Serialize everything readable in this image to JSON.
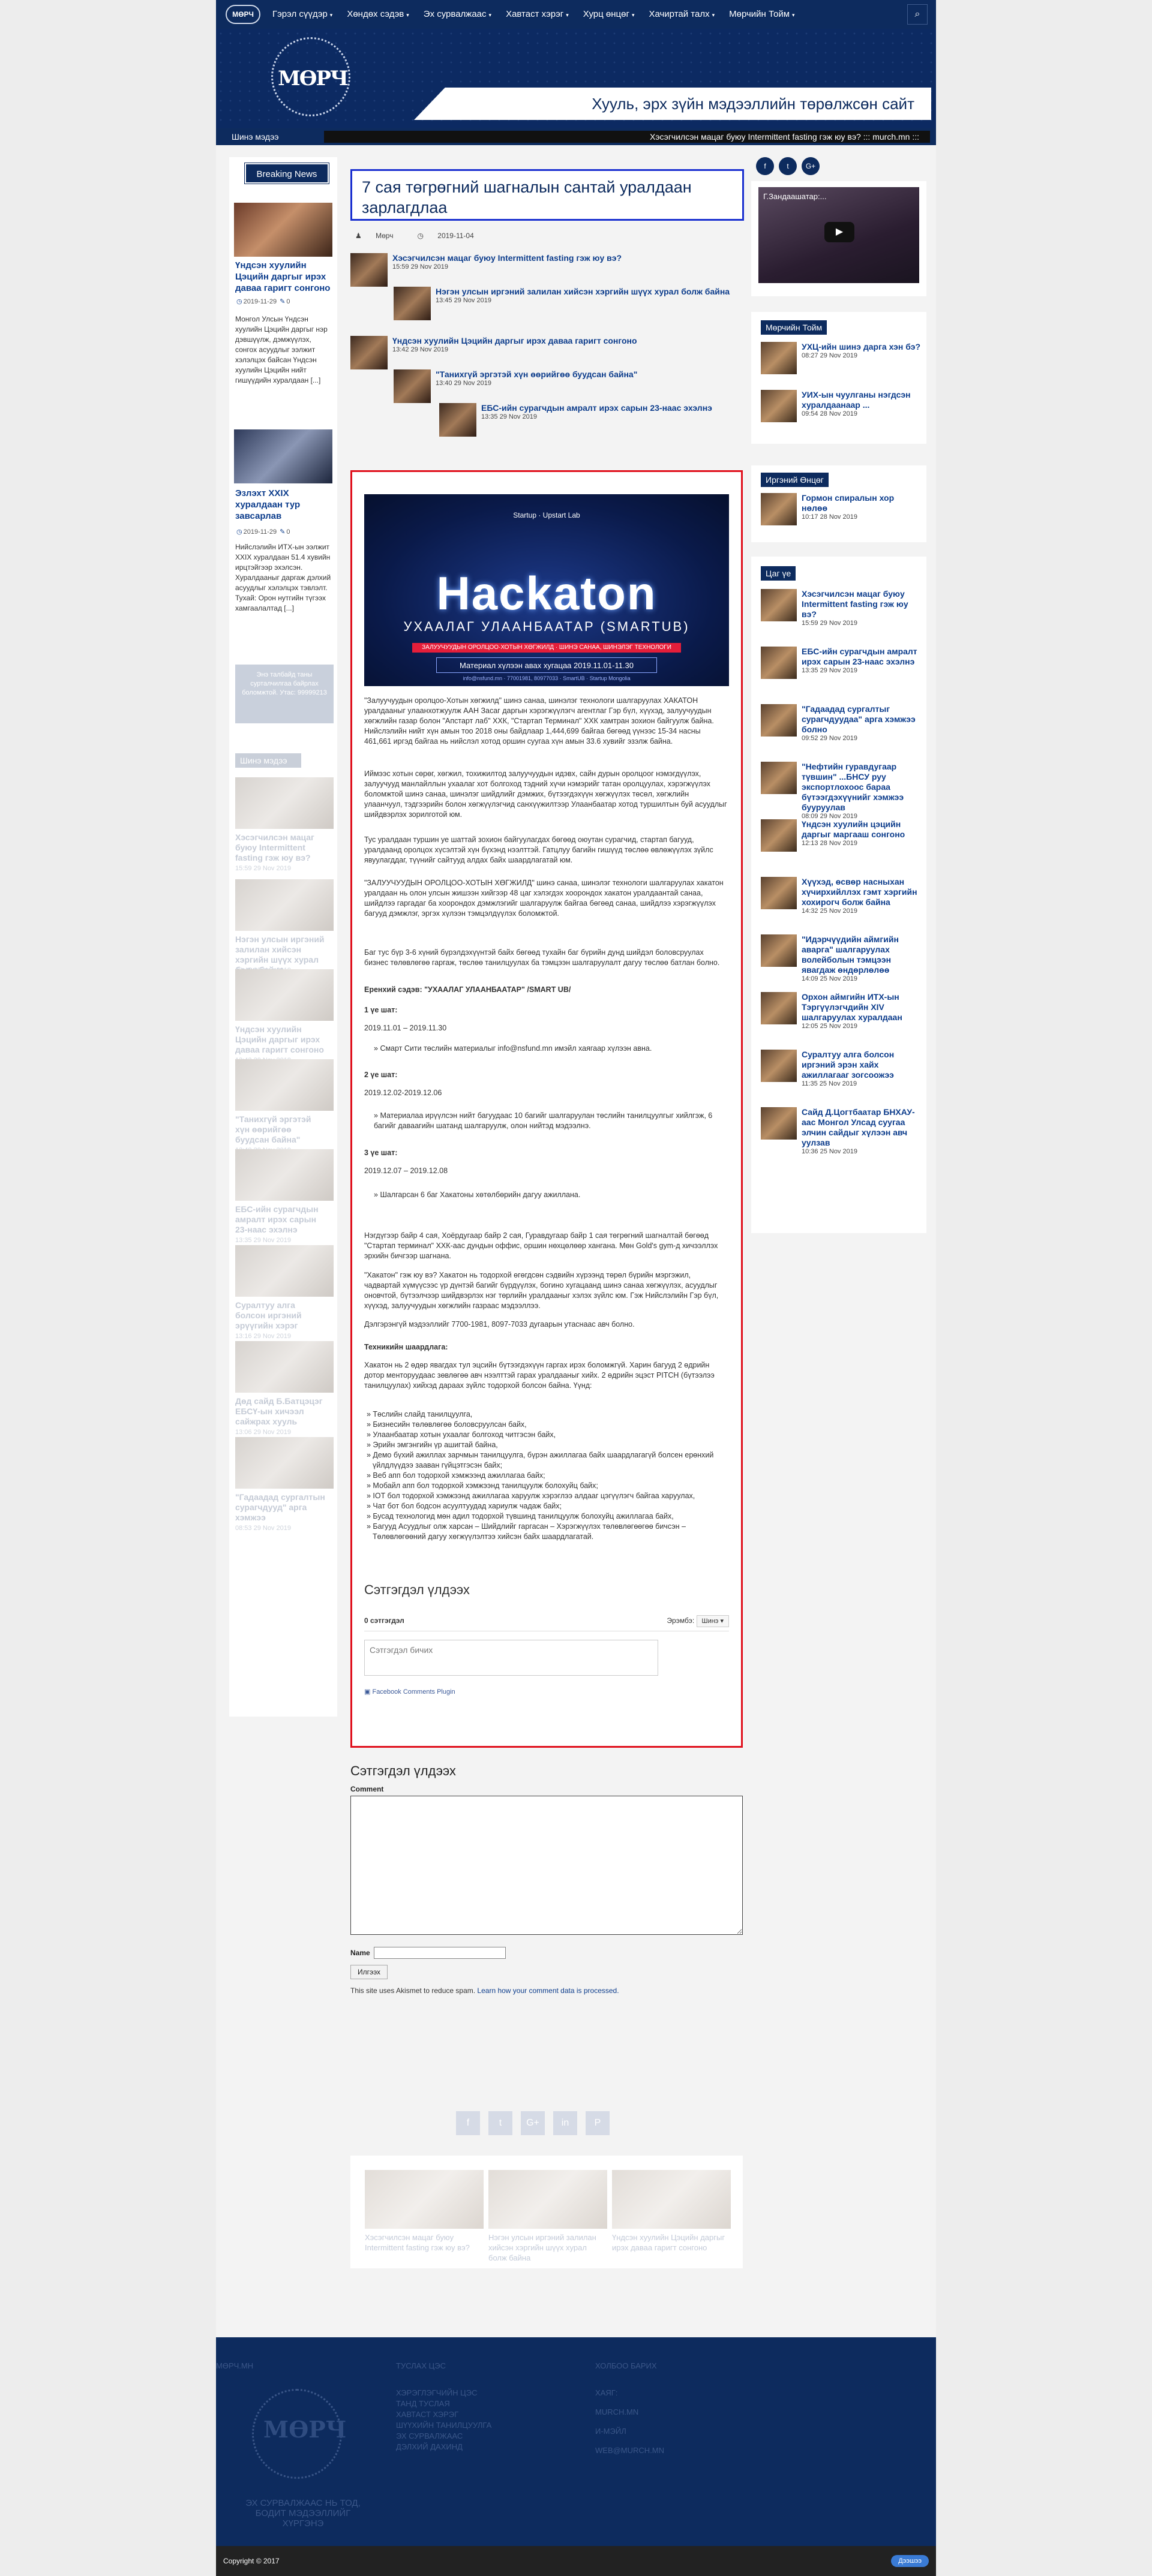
{
  "nav": {
    "logo": "МӨРЧ",
    "items": [
      {
        "label": "Гэрэл сүүдэр",
        "caret": true
      },
      {
        "label": "Хөндөх сэдэв",
        "caret": true
      },
      {
        "label": "Эх сурвалжаас",
        "caret": true
      },
      {
        "label": "Хавтаст хэрэг",
        "caret": true
      },
      {
        "label": "Хурц өнцөг",
        "caret": true
      },
      {
        "label": "Хачиртай талх",
        "caret": true
      },
      {
        "label": "Мөрчийн Тойм",
        "caret": true
      }
    ],
    "search_icon": "⌕"
  },
  "header": {
    "logo_text": "МӨРЧ",
    "tagline": "Хууль, эрх зүйн мэдээллийн төрөлжсөн сайт"
  },
  "ticker": {
    "label": "Шинэ мэдээ",
    "text": "Хэсэгчилсэн мацаг буюу Intermittent fasting гэж юу вэ? ::: murch.mn :::"
  },
  "left": {
    "breaking": "Breaking News",
    "items": [
      {
        "title": "Үндсэн хуулийн Цэцийн даргыг ирэх даваа гаригт сонгоно",
        "date": "2019-11-29",
        "comments": "0",
        "text": "Монгол Улсын Үндсэн хуулийн Цэцийн даргыг нэр дэвшүүлж, дэмжүүлэх, сонгох асуудлыг ээлжит хэлэлцэх байсан Үндсэн хуулийн Цэцийн нийт гишүүдийн хуралдаан [...]"
      },
      {
        "title": "Эзлэхт XXIX хуралдаан тур завсарлав",
        "date": "2019-11-29",
        "comments": "0",
        "text": "Нийслэлийн ИТХ-ын ээлжит XXIX хуралдаан 51.4 хувийн ирцтэйгээр эхэлсэн. Хуралдааныг даргаж дэлхий асуудлыг хэлэлцэх тэвлэлт. Тухай: Орон нутгийн түгээх хамгаалалтад [...]"
      }
    ],
    "ghost_box": "Энэ талбайд таны сурталчилгаа байрлах боломжтой. Утас: 99999213",
    "ghost_head": "Шинэ мэдээ",
    "ghost_items": [
      {
        "t": "Хэсэгчилсэн мацаг буюу Intermittent fasting гэж юу вэ?",
        "d": "15:59 29 Nov 2019"
      },
      {
        "t": "Нэгэн улсын иргэний залилан хийсэн хэргийн шүүх хурал болж байна",
        "d": "13:45 29 Nov 2019"
      },
      {
        "t": "Үндсэн хуулийн Цэцийн даргыг ирэх даваа гаригт сонгоно",
        "d": "13:42 29 Nov 2019"
      },
      {
        "t": "\"Танихгүй эргэтэй хүн өөрийгөө буудсан байна\"",
        "d": "13:40 29 Nov 2019"
      },
      {
        "t": "ЕБС-ийн сурагчдын амралт ирэх сарын 23-наас эхэлнэ",
        "d": "13:35 29 Nov 2019"
      },
      {
        "t": "Суралтуу алга болсон иргэний эрүүгийн хэрэг",
        "d": "13:16 29 Nov 2019"
      },
      {
        "t": "Дөд сайд Б.Батцэцэг ЕБСҮ-ын хичээл сайжрах хууль",
        "d": "13:06 29 Nov 2019"
      },
      {
        "t": "\"Гадаадад сургалтын сурагчдууд\" арга хэмжээ",
        "d": "08:53 29 Nov 2019"
      }
    ]
  },
  "article": {
    "title": "7 сая төгрөгний шагналын сантай уралдаан зарлагдлаа",
    "author": "Мөрч",
    "date": "2019-11-04",
    "related_posts": [
      {
        "t": "Хэсэгчилсэн мацаг буюу Intermittent fasting гэж юу вэ?",
        "d": "15:59 29 Nov 2019"
      },
      {
        "t": "Нэгэн улсын иргэний залилан хийсэн хэргийн шүүх хурал болж байна",
        "d": "13:45 29 Nov 2019"
      },
      {
        "t": "Үндсэн хуулийн Цэцийн даргыг ирэх даваа гаригт сонгоно",
        "d": "13:42 29 Nov 2019"
      },
      {
        "t": "\"Танихгүй эргэтэй хүн өөрийгөө буудсан байна\"",
        "d": "13:40 29 Nov 2019"
      },
      {
        "t": "ЕБС-ийн сурагчдын амралт ирэх сарын 23-наас эхэлнэ",
        "d": "13:35 29 Nov 2019"
      }
    ],
    "banner": {
      "top": "Startup · Upstart Lab",
      "title": "Hackaton",
      "subtitle": "УХААЛАГ УЛААНБААТАР (SMARTUB)",
      "bar": "ЗАЛУУЧУУДЫН ОРОЛЦОО·ХОТЫН ХӨГЖИЛД · ШИНЭ САНАА, ШИНЭЛЭГ ТЕХНОЛОГИ",
      "date": "Материал хүлээн авах хугацаа 2019.11.01-11.30",
      "foot": "info@nsfund.mn · 77001981, 80977033 · SmartUB · Startup Mongolia"
    },
    "p1": "\"Залуучуудын оролцоо-Хотын хөгжилд\" шинэ санаа, шинэлэг технологи шалгаруулах ХАКАТОН уралдааныг улаанхотжуулж ААН Засаг даргын хэрэгжүүлэгч агентлаг Гэр бүл, хүүхэд, залуучуудын хөгжлийн газар болон \"Апстарт лаб\" ХХК, \"Стартап Терминал\" ХХК хамтран зохион байгуулж байна. Нийслэлийн нийт хүн амын тоо 2018 оны байдлаар 1,444,699 байгаа бөгөөд үүнээс 15-34 насны 461,661 иргэд байгаа нь нийслэл хотод оршин суугаа хүн амын 33.6 хувийг эзэлж байна.",
    "p2": "Иймээс хотын сөрөг, хөгжил, тохижилтод залуучуудын идэвх, сайн дурын оролцоог нэмэгдүүлэх, залуучууд манлайллын ухаалаг хот болгоход тэдний хүчи нэмэрийг татан оролцуулах, хэрэгжүүлэх боломжтой шинэ санаа, шинэлэг шийдлийг дэмжих, бүтээгдэхүүн хөгжүүлэх төсөл, хөгжлийн улаанчуул, тэдгээрийн болон хөгжүүлэгчид санхүүжилтээр Улаанбаатар хотод туршилтын буй асуудлыг шийдвэрлэх зорилготой юм.",
    "p3": "Тус уралдаан туршин уе шаттай зохион байгуулагдах бөгөөд оюутан сурагчид, стартап багууд, уралдаанд оролцох хүсэлтэй хүн бүхэнд нээлттэй. Гатцлуу багийн гишүүд төслөө өвлөжүүлэх зүйлс явуулагддаг, түүнийг сайтууд алдах байх шаардлагатай юм.",
    "p4": "\"ЗАЛУУЧУУДЫН ОРОЛЦОО-ХОТЫН ХӨГЖИЛД\" шинэ санаа, шинэлэг технологи шалгаруулах хакатон уралдаан нь олон улсын жишээн хийгээр 48 цаг хэлэгдэх хоорондох хакатон уралдаантай санаа, шийдлээ гаргадаг ба хоорондох дэмжлэгийг шалгаруулж байгаа бөгөөд санаа, шийдлээ хэрэгжүүлэх багууд дэмжлэг, эргэх хүлээн тэмцэлдүүлэх боломжтой.",
    "p5": "Баг тус бүр 3-6 хүний бүрэлдэхүүнтэй байх бөгөөд тухайн баг бүрийн дунд шийдэл боловсруулах бизнес төлөвлөгөө гаргаж, төслөө танилцуулах ба тэмцээн шалгаруулалт дагуу төслөө батлан болно.",
    "focus": "Еренхий сэдэв: \"УХААЛАГ УЛААНБААТАР\" /SMART UB/",
    "s1h": "1 үе шат:",
    "s1d": "2019.11.01 – 2019.11.30",
    "s1t": "Смарт Сити төслийн материалыг info@nsfund.mn имэйл хаягаар хүлээн авна.",
    "s2h": "2 үе шат:",
    "s2d": "2019.12.02-2019.12.06",
    "s2t": "Материалаа ирүүлсэн нийт багуудаас 10 багийг шалгаруулан төслийн танилцуулгыг хийлгэж, 6 багийг даваагийн шатанд шалгаруулж, олон нийтэд мэдээлнэ.",
    "s3h": "3 үе шат:",
    "s3d": "2019.12.07 – 2019.12.08",
    "s3t": "Шалгарсан 6 баг Хакатоны хөтөлбөрийн дагуу ажиллана.",
    "p6": "Нэгдүгээр байр 4 сая, Хоёрдугаар байр 2 сая, Гуравдугаар байр 1 сая төгрөгний шагналтай бөгөөд \"Стартап терминал\" ХХК-аас дундын оффис, оршин нөхцөлөөр хангана. Мөн Gold's gym-д хичээллэх эрхийн бичгээр шагнана.",
    "p7": "\"Хакатон\" гэж юу вэ? Хакатон нь тодорхой өгөгдсөн сэдвийн хүрээнд төрөл бүрийн мэргэжил, чадвартай хүмүүсээс үр дүнтэй багийг бүрдүүлэх, богино хугацаанд шинэ санаа хөгжүүлэх, асуудлыг оновчтой, бүтээлчээр шийдвэрлэх нэг төрлийн уралдааныг хэлэх зүйлс юм. Гэж Нийслэлийн Гэр бүл, хүүхэд, залуучуудын хөгжлийн газраас мэдээллээ.",
    "contact": "Дэлгэрэнгүй мэдээллийг 7700-1981, 8097-7033 дугаарын утаснаас авч болно.",
    "tech_h": "Техникийн шаардлага:",
    "tech_p": "Хакатон нь 2 өдөр явагдах тул эцсийн бүтээгдэхүүн гаргах ирэх боломжгүй. Харин багууд 2 өдрийн дотор менторуудаас зөвлөгөө авч нээлттэй гарах уралдааныг хийх. 2 өдрийн эцэст PITCH (бүтээлээ танилцуулах) хийхэд дараах зүйлс тодорхой болсон байна. Үүнд:",
    "tech_list": [
      "Төслийн слайд танилцуулга,",
      "Бизнесийн төлөвлөгөө боловсруулсан байх,",
      "Улаанбаатар хотын ухаалаг болгоход читгэсэн байх,",
      "Эрийн эмгэнгийн үр ашигтай байна,",
      "Демо бүхий ажиллах зарчмын танилцуулга, бүрэн ажиллагаа байх шаардлагагүй болсен ерөнхий үйлдлүүдээ зааван гүйцэтгэсэн байх;",
      "Веб апп бол тодорхой хэмжээнд ажиллагаа байх;",
      "Мобайл апп бол тодорхой хэмжээнд танилцуулж болохуйц байх;",
      "IOT бол тодорхой хэмжээнд ажиллагаа харуулж хэрэглээ алдааг цэгүүлэгч байгаа харуулах,",
      "Чат бот бол бодсон асуултуудад хариулж чадаж байх;",
      "Бусад технологид мөн адил тодорхой түвшинд танилцуулж болохуйц ажиллагаа байх,",
      "Багууд Асуудлыг олж харсан – Шийдлийг гаргасан – Хэрэгжүүлэх төлөвлөгөөгөө бичсэн – Төлөвлөгөөний дагуу хөгжүүлэлтээ хийсэн байх шаардлагатай."
    ],
    "fb": {
      "title": "Сэтгэгдэл үлдээх",
      "count": "0 сэтгэгдэл",
      "sort_label": "Эрэмбэ:",
      "sort_value": "Шинэ ▾",
      "placeholder": "Сэтгэгдэл бичих",
      "plugin": "Facebook Comments Plugin"
    }
  },
  "reply": {
    "title": "Сэтгэгдэл үлдээх",
    "comment_label": "Comment",
    "name_label": "Name",
    "submit": "Илгээх",
    "note": "This site uses Akismet to reduce spam. ",
    "note_link": "Learn how your comment data is processed."
  },
  "share": [
    "f",
    "t",
    "G+",
    "in",
    "P"
  ],
  "related": [
    {
      "t": "Хэсэгчилсэн мацаг буюу Intermittent fasting гэж юу вэ?"
    },
    {
      "t": "Нэгэн улсын иргэний залилан хийсэн хэргийн шүүх хурал болж байна"
    },
    {
      "t": "Үндсэн хуулийн Цэцийн даргыг ирэх даваа гаригт сонгоно"
    }
  ],
  "sidebar": {
    "social": [
      "f",
      "t",
      "G+"
    ],
    "video_title": "Г.Зандаашатар:...",
    "murch_head": "Мөрчийн Тойм",
    "murch": [
      {
        "t": "УХЦ-ийн шинэ дарга хэн бэ?",
        "d": "08:27 29 Nov 2019"
      },
      {
        "t": "УИХ-ын чуулганы нэгдсэн хуралдаанаар ...",
        "d": "09:54 28 Nov 2019"
      }
    ],
    "angle_head": "Иргэний Өнцөг",
    "angle": [
      {
        "t": "Гормон спиралын хор нөлөө",
        "d": "10:17 28 Nov 2019"
      }
    ],
    "time_head": "Цаг үе",
    "time": [
      {
        "t": "Хэсэгчилсэн мацаг буюу Intermittent fasting гэж юу вэ?",
        "d": "15:59 29 Nov 2019"
      },
      {
        "t": "ЕБС-ийн сурагчдын амралт ирэх сарын 23-наас эхэлнэ",
        "d": "13:35 29 Nov 2019"
      },
      {
        "t": "\"Гадаадад сургалтыг сурагчдуудаа\" арга хэмжээ болно",
        "d": "09:52 29 Nov 2019"
      },
      {
        "t": "\"Нефтийн гуравдугаар түвшин\" ...БНСУ руу экспортлохоос бараа бүтээгдэхүүнийг хэмжээ бууруулав",
        "d": "08:09 29 Nov 2019"
      },
      {
        "t": "Үндсэн хуулийн цэцийн даргыг маргааш сонгоно",
        "d": "12:13 28 Nov 2019"
      },
      {
        "t": "Хүүхэд, өсвөр насныхан хүчирхийллэх гэмт хэргийн хохирогч болж байна",
        "d": "14:32 25 Nov 2019"
      },
      {
        "t": "\"Идэрчүүдийн аймгийн аварга\" шалгаруулах волейболын тэмцээн явагдаж өндөрлөлөө",
        "d": "14:09 25 Nov 2019"
      },
      {
        "t": "Орхон аймгийн ИТХ-ын Тэргүүлэгчдийн XIV шалгаруулах хуралдаан",
        "d": "12:05 25 Nov 2019"
      },
      {
        "t": "Суралтуу алга болсон иргэний эрэн хайх ажиллагааг зогсоожээ",
        "d": "11:35 25 Nov 2019"
      },
      {
        "t": "Сайд Д.Цогтбаатар БНХАУ-аас Монгол Улсад суугаа элчин сайдыг хүлээн авч уулзав",
        "d": "10:36 25 Nov 2019"
      }
    ]
  },
  "footer": {
    "col1": "МӨРЧ.МН",
    "col2": "ТУСЛАХ ЦЭС",
    "col3": "ХОЛБОО БАРИХ",
    "links": [
      "ХЭРЭГЛЭГЧИЙН ЦЭС",
      "ТАНД ТУСЛАЯ",
      "ХАВТАСТ ХЭРЭГ",
      "ШҮҮХИЙН ТАНИЛЦУУЛГА",
      "ЭХ СУРВАЛЖААС",
      "ДЭЛХИЙ ДАХИНД"
    ],
    "contact": [
      "ХАЯГ:",
      "MURCH.MN",
      "И-МЭЙЛ",
      "WEB@MURCH.MN"
    ],
    "logo": "МӨРЧ",
    "slogan": "ЭХ СУРВАЛЖААС НЬ ТОД, БОДИТ МЭДЭЭЛЛИЙГ ХҮРГЭНЭ"
  },
  "copyright": "Copyright © 2017",
  "top_btn": "Дээшээ"
}
